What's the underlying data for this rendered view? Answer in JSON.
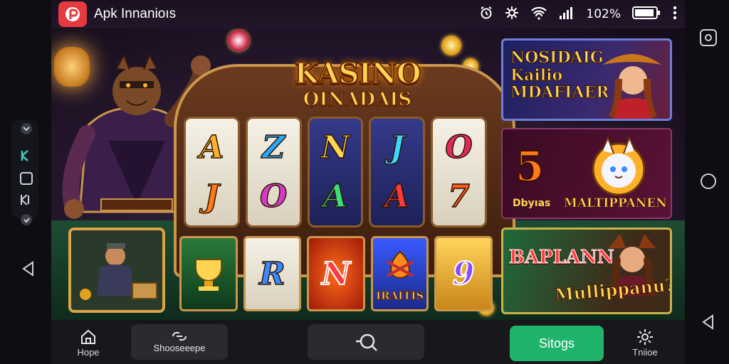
{
  "status_bar": {
    "app_title": "Apk Innanioıs",
    "battery_percent": "102%",
    "icons": [
      "alarm-icon",
      "settings-gear-icon",
      "wifi-icon",
      "signal-icon",
      "battery-icon",
      "more-icon"
    ]
  },
  "game": {
    "title_line1": "KASINO",
    "title_line2": "OINADAIS",
    "reels": [
      {
        "top": "A",
        "bottom": "J"
      },
      {
        "top": "Z",
        "bottom": "O"
      },
      {
        "top": "N",
        "bottom": "A"
      },
      {
        "top": "J",
        "bottom": "A"
      },
      {
        "top": "O",
        "bottom": "7"
      }
    ],
    "tiles": [
      {
        "symbol": "",
        "label": ""
      },
      {
        "symbol": "R",
        "label": ""
      },
      {
        "symbol": "N",
        "label": ""
      },
      {
        "symbol": "",
        "label": "IRAITIS"
      },
      {
        "symbol": "9",
        "label": ""
      }
    ]
  },
  "promos": {
    "panel1": {
      "line1": "NOSIDAIG",
      "line2": "Kailio",
      "line3": "MDAFIAER"
    },
    "panel2": {
      "number": "5",
      "small": "Dbyıas",
      "big": "MALTIPPANEN"
    },
    "panel3": {
      "line1": "BAPLANN",
      "line2": "Mullippanu?"
    }
  },
  "nav": {
    "home_label": "Hope",
    "search_pill_label": "Shooseeepe",
    "cta_label": "Sitogs",
    "settings_label": "Tniioe"
  },
  "colors": {
    "accent_green": "#1fb36b",
    "app_icon_red": "#e53a3f",
    "gold": "#ffd451"
  }
}
